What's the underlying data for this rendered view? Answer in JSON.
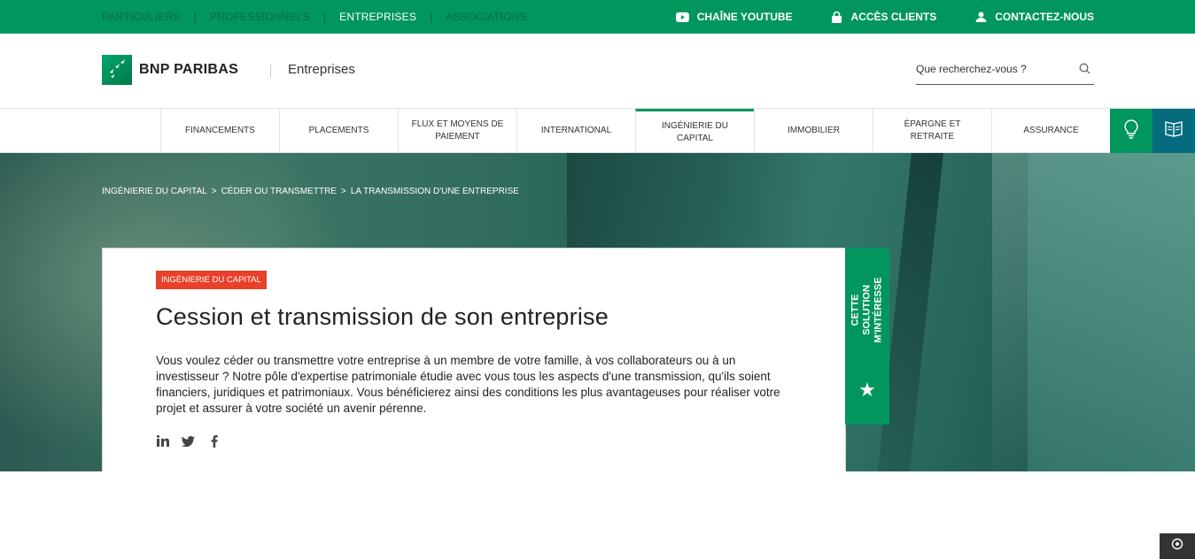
{
  "topbar": {
    "segments": [
      {
        "label": "PARTICULIERS",
        "active": false
      },
      {
        "label": "PROFESSIONNELS",
        "active": false
      },
      {
        "label": "ENTREPRISES",
        "active": true
      },
      {
        "label": "ASSOCIATIONS",
        "active": false
      }
    ],
    "youtube_label": "CHAÎNE YOUTUBE",
    "youtube_icon": "youtube-icon",
    "clients_label": "ACCÈS CLIENTS",
    "clients_icon": "lock-icon",
    "contact_label": "CONTACTEZ-NOUS",
    "contact_icon": "user-icon",
    "color": "#00965e"
  },
  "header": {
    "logo_text": "BNP PARIBAS",
    "logo_subtitle": "Entreprises",
    "search_placeholder": "Que recherchez-vous ?",
    "search_icon": "search-icon"
  },
  "nav": {
    "items": [
      {
        "label": "FINANCEMENTS"
      },
      {
        "label": "PLACEMENTS"
      },
      {
        "label": "FLUX ET MOYENS DE PAIEMENT"
      },
      {
        "label": "INTERNATIONAL"
      },
      {
        "label": "INGÉNIERIE DU CAPITAL"
      },
      {
        "label": "IMMOBILIER"
      },
      {
        "label": "ÉPARGNE ET RETRAITE"
      },
      {
        "label": "ASSURANCE"
      }
    ],
    "active_index": 4,
    "idea_icon": "lightbulb-icon",
    "book_icon": "book-icon"
  },
  "breadcrumb": {
    "items": [
      "INGÉNIERIE DU CAPITAL",
      "CÉDER OU TRANSMETTRE",
      "LA TRANSMISSION D'UNE ENTREPRISE"
    ],
    "separator": ">"
  },
  "article": {
    "badge": "INGÉNIERIE DU CAPITAL",
    "badge_color": "#e8402a",
    "title": "Cession et transmission de son entreprise",
    "body": "Vous voulez céder ou transmettre votre entreprise à un membre de votre famille, à vos collaborateurs ou à un investisseur ? Notre pôle d'expertise patrimoniale étudie avec vous tous les aspects d'une transmission, qu'ils soient financiers, juridiques et patrimoniaux. Vous bénéficierez ainsi des conditions les plus avantageuses pour réaliser votre projet et assurer à votre société un avenir pérenne.",
    "social": [
      "linkedin-icon",
      "twitter-icon",
      "facebook-icon"
    ]
  },
  "side_tab": {
    "label": "CETTE SOLUTION M'INTÉRESSE",
    "icon": "star-icon"
  },
  "corner": {
    "icon": "target-icon"
  }
}
